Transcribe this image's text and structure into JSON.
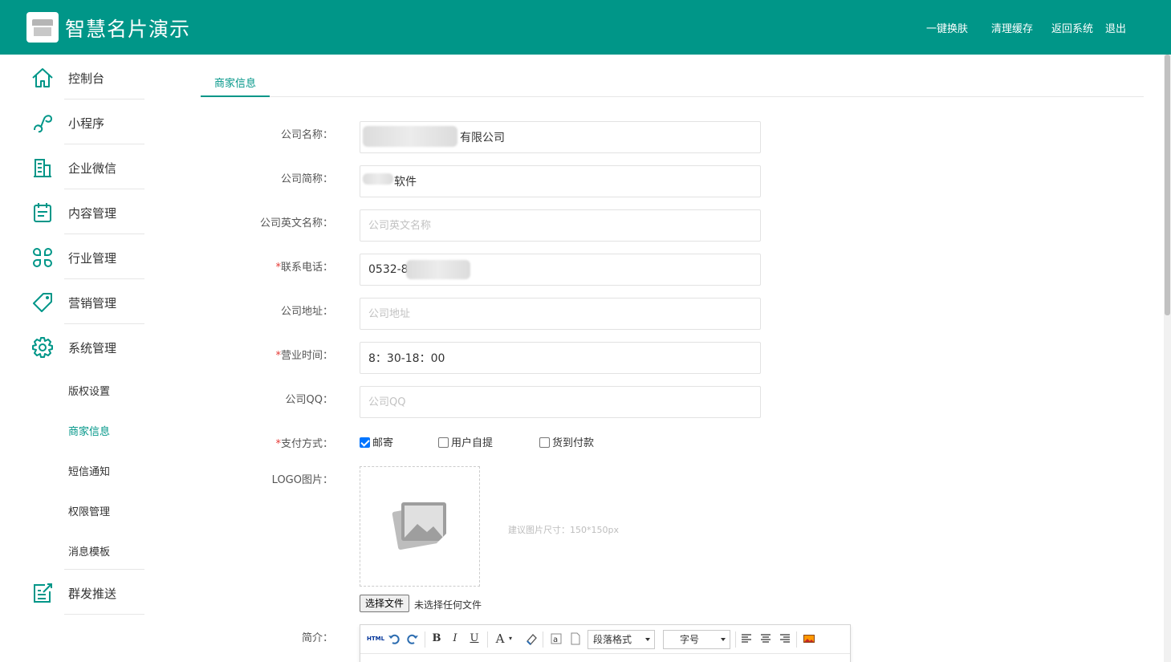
{
  "header": {
    "title": "智慧名片演示",
    "links": [
      "一键换肤",
      "清理缓存",
      "返回系统",
      "退出"
    ]
  },
  "sidebar": {
    "items": [
      {
        "label": "控制台",
        "icon": "home-icon"
      },
      {
        "label": "小程序",
        "icon": "miniprogram-icon"
      },
      {
        "label": "企业微信",
        "icon": "building-icon"
      },
      {
        "label": "内容管理",
        "icon": "clipboard-icon"
      },
      {
        "label": "行业管理",
        "icon": "clover-icon"
      },
      {
        "label": "营销管理",
        "icon": "tag-icon"
      },
      {
        "label": "系统管理",
        "icon": "gear-icon"
      },
      {
        "label": "群发推送",
        "icon": "edit-export-icon"
      }
    ],
    "subitems": [
      "版权设置",
      "商家信息",
      "短信通知",
      "权限管理",
      "消息模板"
    ],
    "active_subitem": "商家信息"
  },
  "tab": {
    "label": "商家信息"
  },
  "form": {
    "company_name": {
      "label": "公司名称：",
      "value": "有限公司",
      "placeholder": ""
    },
    "short_name": {
      "label": "公司简称：",
      "value": "软件",
      "placeholder": ""
    },
    "english_name": {
      "label": "公司英文名称：",
      "value": "",
      "placeholder": "公司英文名称"
    },
    "phone": {
      "label": "联系电话：",
      "required": "*",
      "value": "0532-8",
      "placeholder": ""
    },
    "address": {
      "label": "公司地址：",
      "value": "",
      "placeholder": "公司地址"
    },
    "hours": {
      "label": "营业时间：",
      "required": "*",
      "value": "8：30-18：00",
      "placeholder": ""
    },
    "qq": {
      "label": "公司QQ：",
      "value": "",
      "placeholder": "公司QQ"
    },
    "payment": {
      "label": "支付方式：",
      "required": "*",
      "options": [
        {
          "label": "邮寄",
          "checked": true
        },
        {
          "label": "用户自提",
          "checked": false
        },
        {
          "label": "货到付款",
          "checked": false
        }
      ]
    },
    "logo": {
      "label": "LOGO图片：",
      "hint": "建议图片尺寸：150*150px",
      "button": "选择文件",
      "file_status": "未选择任何文件"
    },
    "intro": {
      "label": "简介：",
      "toolbar": {
        "html": "HTML",
        "bold": "B",
        "italic": "I",
        "underline": "U",
        "font_color": "A",
        "paragraph_select": "段落格式",
        "size_select": "字号"
      }
    }
  },
  "colors": {
    "primary": "#009688",
    "required": "#e53935"
  }
}
